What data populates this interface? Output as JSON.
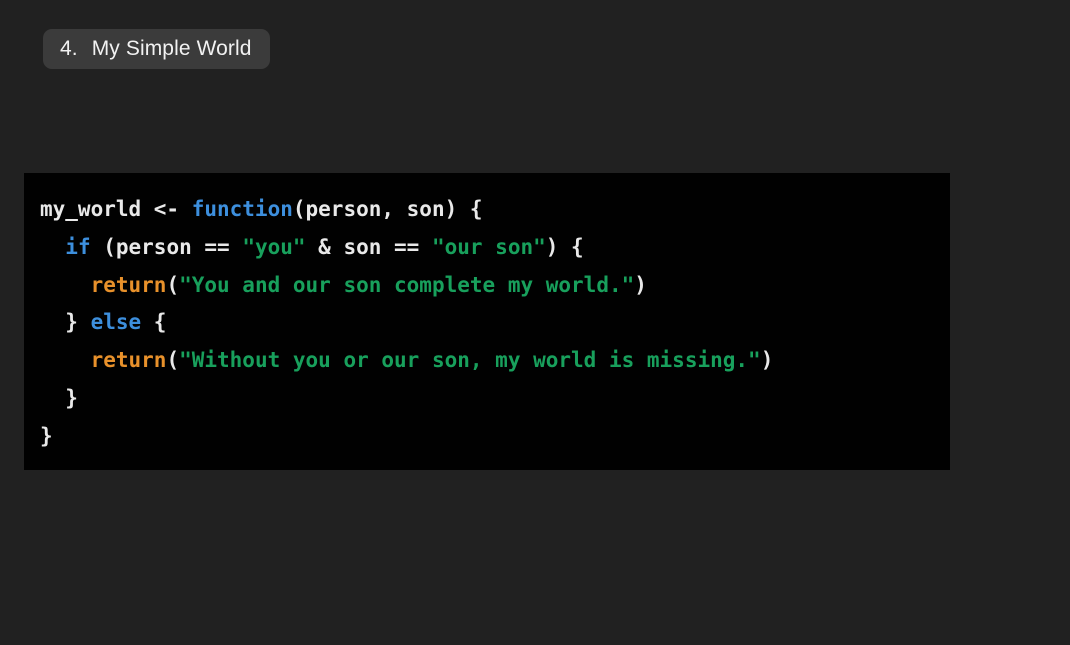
{
  "page": {
    "background_color": "#212121"
  },
  "title_chip": {
    "number": "4.",
    "text": "My Simple World",
    "background_color": "#3b3b3b",
    "text_color": "#f2f2f2"
  },
  "code_block": {
    "language": "r",
    "background_color": "#010101",
    "colors": {
      "plain": "#e9e9e9",
      "keyword": "#3d8fdd",
      "function": "#e8912b",
      "string": "#18a05c"
    },
    "plain_text": "my_world <- function(person, son) {\n  if (person == \"you\" & son == \"our son\") {\n    return(\"You and our son complete my world.\")\n  } else {\n    return(\"Without you or our son, my world is missing.\")\n  }\n}",
    "lines": [
      {
        "index": 1,
        "tokens": [
          {
            "t": "my_world <- ",
            "c": "plain"
          },
          {
            "t": "function",
            "c": "keyword"
          },
          {
            "t": "(person, son) {",
            "c": "plain"
          }
        ]
      },
      {
        "index": 2,
        "tokens": [
          {
            "t": "  ",
            "c": "plain"
          },
          {
            "t": "if",
            "c": "keyword"
          },
          {
            "t": " (person == ",
            "c": "plain"
          },
          {
            "t": "\"you\"",
            "c": "string"
          },
          {
            "t": " & son == ",
            "c": "plain"
          },
          {
            "t": "\"our son\"",
            "c": "string"
          },
          {
            "t": ") {",
            "c": "plain"
          }
        ]
      },
      {
        "index": 3,
        "tokens": [
          {
            "t": "    ",
            "c": "plain"
          },
          {
            "t": "return",
            "c": "function"
          },
          {
            "t": "(",
            "c": "plain"
          },
          {
            "t": "\"You and our son complete my world.\"",
            "c": "string"
          },
          {
            "t": ")",
            "c": "plain"
          }
        ]
      },
      {
        "index": 4,
        "tokens": [
          {
            "t": "  } ",
            "c": "plain"
          },
          {
            "t": "else",
            "c": "keyword"
          },
          {
            "t": " {",
            "c": "plain"
          }
        ]
      },
      {
        "index": 5,
        "tokens": [
          {
            "t": "    ",
            "c": "plain"
          },
          {
            "t": "return",
            "c": "function"
          },
          {
            "t": "(",
            "c": "plain"
          },
          {
            "t": "\"Without you or our son, my world is missing.\"",
            "c": "string"
          },
          {
            "t": ")",
            "c": "plain"
          }
        ]
      },
      {
        "index": 6,
        "tokens": [
          {
            "t": "  }",
            "c": "plain"
          }
        ]
      },
      {
        "index": 7,
        "tokens": [
          {
            "t": "}",
            "c": "plain"
          }
        ]
      }
    ]
  }
}
